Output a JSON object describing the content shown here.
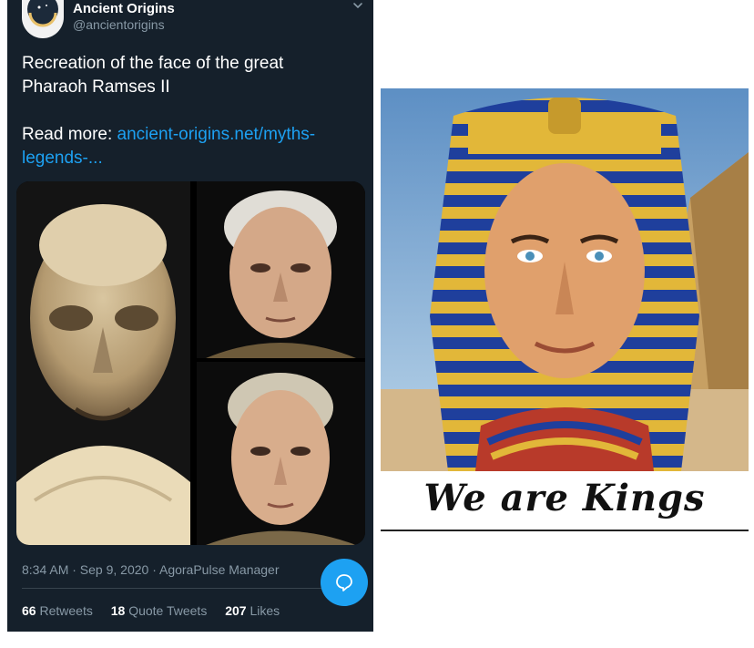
{
  "tweet": {
    "author_name": "Ancient Origins",
    "author_handle": "@ancientorigins",
    "text_line1": "Recreation of the face of the great",
    "text_line2": "Pharaoh Ramses II",
    "read_more_label": "Read more: ",
    "link_text_1": "ancient-origins.net/myths-",
    "link_text_2": "legends-...",
    "timestamp": "8:34 AM · Sep 9, 2020 · AgoraPulse Manager",
    "stats": {
      "retweets_count": "66",
      "retweets_label": "Retweets",
      "quote_tweets_count": "18",
      "quote_tweets_label": "Quote Tweets",
      "likes_count": "207",
      "likes_label": "Likes"
    },
    "icons": {
      "avatar": "ancient-origins-logo",
      "more": "chevron-down-icon",
      "reply": "reply-bubble-icon"
    },
    "colors": {
      "background": "#15202b",
      "link": "#1da1f2",
      "muted": "#8899a6",
      "fab": "#1da1f2"
    }
  },
  "meme": {
    "caption": "We are Kings"
  }
}
